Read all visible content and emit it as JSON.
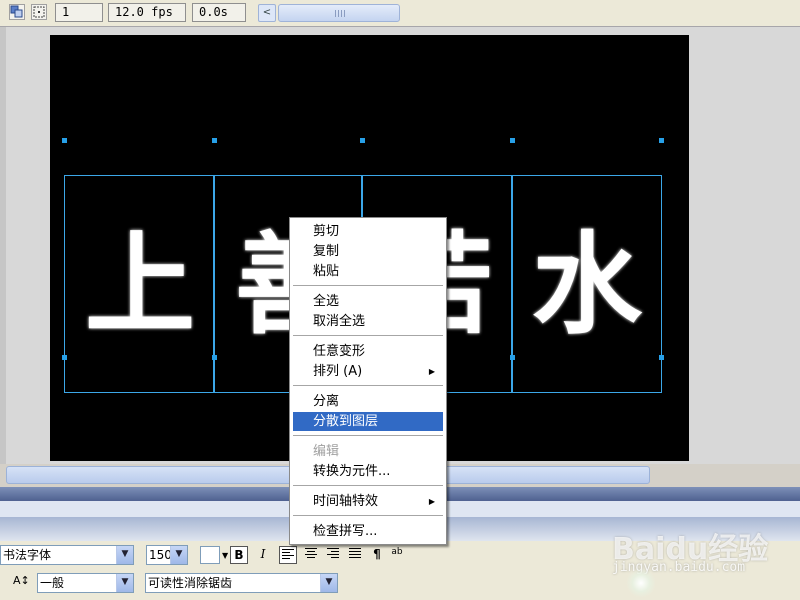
{
  "toolbar": {
    "frame": "1",
    "fps": "12.0 fps",
    "time": "0.0s",
    "scroll_left_glyph": "<",
    "icons": [
      "onion-skin-icon",
      "center-frame-icon"
    ]
  },
  "stage": {
    "background": "#000000",
    "characters": [
      "上",
      "善",
      "若",
      "水"
    ],
    "selection_color": "#3ca7e8"
  },
  "context_menu": {
    "items": [
      {
        "label": "剪切"
      },
      {
        "label": "复制"
      },
      {
        "label": "粘贴"
      },
      {
        "label": "全选"
      },
      {
        "label": "取消全选"
      },
      {
        "label": "任意变形"
      },
      {
        "label": "排列 (A)",
        "submenu": true
      },
      {
        "label": "分离"
      },
      {
        "label": "分散到图层",
        "highlighted": true
      },
      {
        "label": "编辑",
        "disabled": true
      },
      {
        "label": "转换为元件..."
      },
      {
        "label": "时间轴特效",
        "submenu": true
      },
      {
        "label": "检查拼写..."
      }
    ],
    "submenu_glyph": "▶",
    "highlight_color": "#316ac5"
  },
  "properties": {
    "font_family": "书法字体",
    "font_size": "150",
    "bold": "B",
    "italic": "I",
    "paragraph": "¶",
    "spell_glyph": "ab",
    "text_size_glyph": "A↕",
    "line_type": "一般",
    "antialias": "可读性消除锯齿",
    "dropdown_glyph": "▼"
  },
  "watermark": {
    "logo": "Baidu经验",
    "url": "jingyan.baidu.com"
  }
}
